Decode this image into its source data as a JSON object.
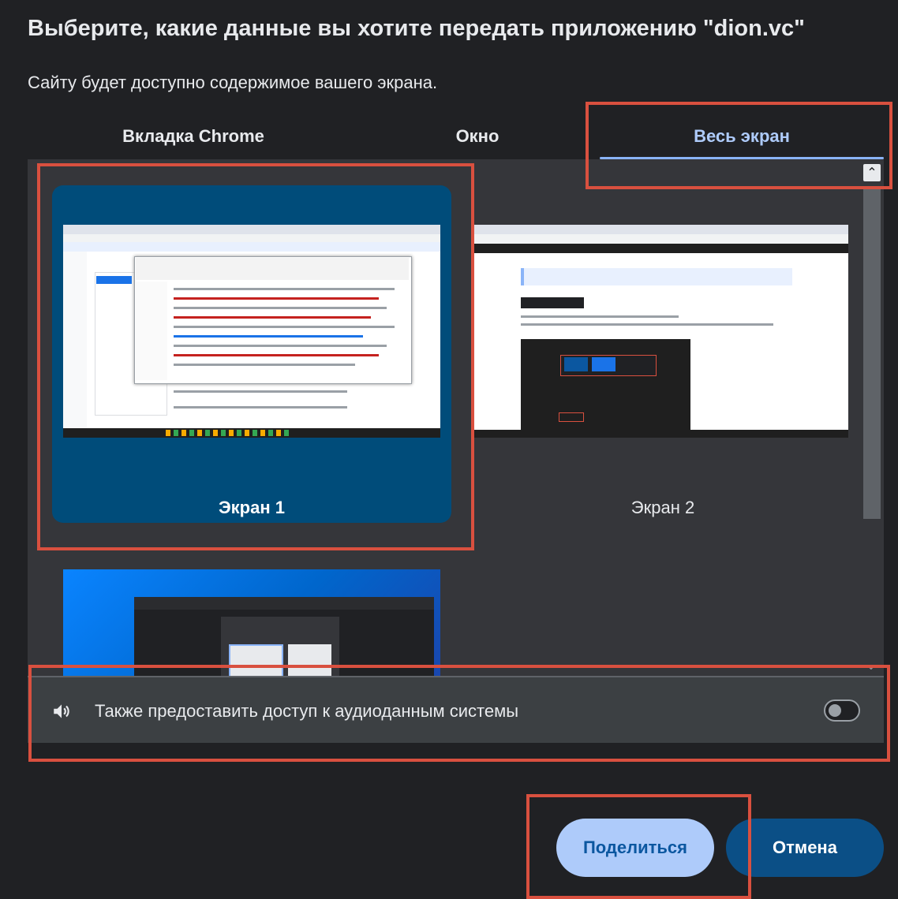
{
  "dialog": {
    "title": "Выберите, какие данные вы хотите передать приложению \"dion.vc\"",
    "subtitle": "Сайту будет доступно содержимое вашего экрана."
  },
  "tabs": [
    {
      "label": "Вкладка Chrome",
      "active": false
    },
    {
      "label": "Окно",
      "active": false
    },
    {
      "label": "Весь экран",
      "active": true
    }
  ],
  "screens": [
    {
      "label": "Экран 1",
      "selected": true
    },
    {
      "label": "Экран 2",
      "selected": false
    },
    {
      "label": "",
      "selected": false
    }
  ],
  "audio": {
    "label": "Также предоставить доступ к аудиоданным системы",
    "enabled": false,
    "icon": "speaker-icon"
  },
  "buttons": {
    "share": "Поделиться",
    "cancel": "Отмена"
  },
  "colors": {
    "accent": "#8ab4f8",
    "selected_card": "#004c7a",
    "highlight": "#d9503f",
    "share_bg": "#aecbfa",
    "cancel_bg": "#0b4f86"
  }
}
